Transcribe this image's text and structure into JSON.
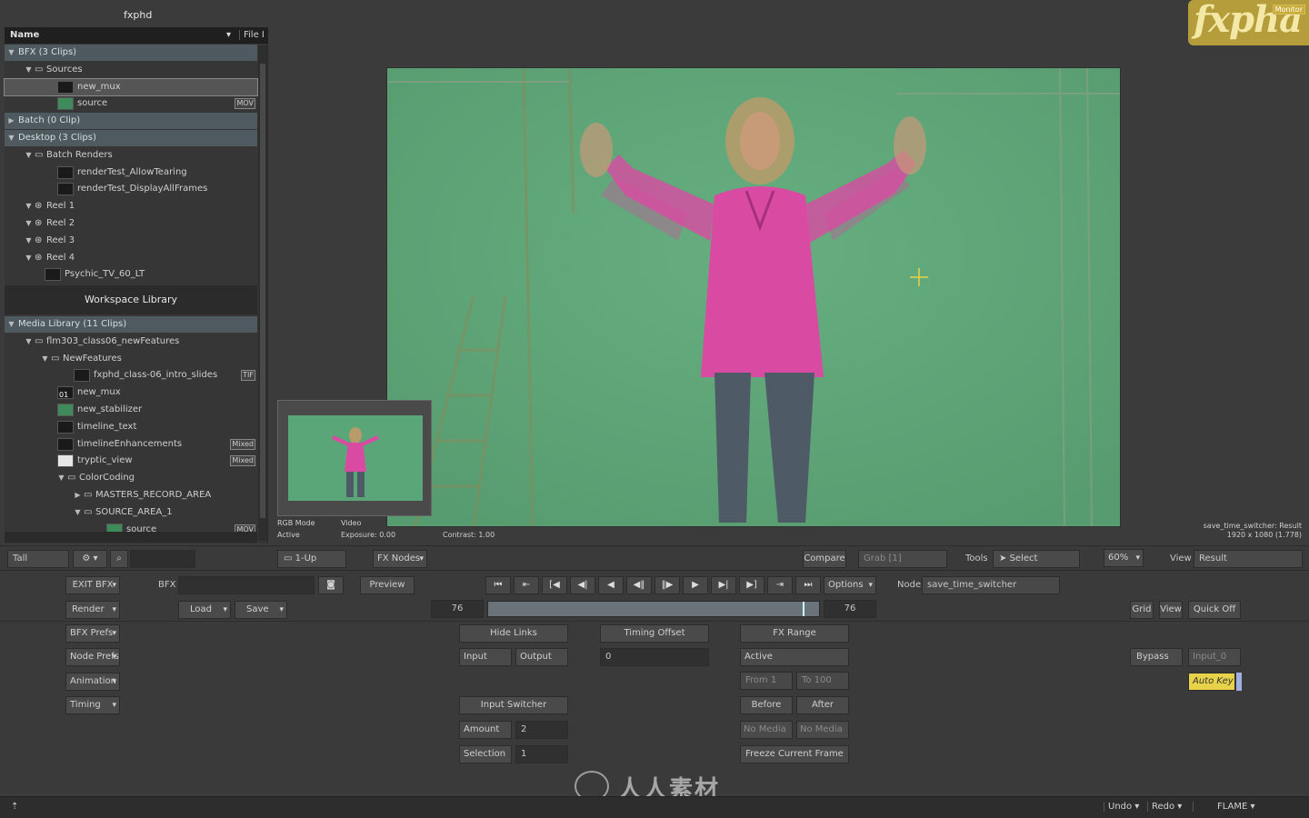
{
  "app": {
    "title": "fxphd"
  },
  "library": {
    "header": {
      "name": "Name",
      "file": "File I"
    },
    "rows": [
      {
        "label": "BFX (3 Clips)",
        "type": "group"
      },
      {
        "label": "Sources",
        "type": "folder"
      },
      {
        "label": "new_mux",
        "type": "clip",
        "selected": true
      },
      {
        "label": "source",
        "type": "clip",
        "tag": "MOV"
      },
      {
        "label": "Batch (0 Clip)",
        "type": "group"
      },
      {
        "label": "Desktop (3 Clips)",
        "type": "group"
      },
      {
        "label": "Batch Renders",
        "type": "folder"
      },
      {
        "label": "renderTest_AllowTearing",
        "type": "clip"
      },
      {
        "label": "renderTest_DisplayAllFrames",
        "type": "clip"
      },
      {
        "label": "Reel 1",
        "type": "reel"
      },
      {
        "label": "Reel 2",
        "type": "reel"
      },
      {
        "label": "Reel 3",
        "type": "reel"
      },
      {
        "label": "Reel 4",
        "type": "reel"
      },
      {
        "label": "Psychic_TV_60_LT",
        "type": "clip"
      }
    ],
    "workspace_library": "Workspace Library",
    "media_rows": [
      {
        "label": "Media Library (11 Clips)",
        "type": "group"
      },
      {
        "label": "flm303_class06_newFeatures",
        "type": "folder"
      },
      {
        "label": "NewFeatures",
        "type": "folder"
      },
      {
        "label": "fxphd_class-06_intro_slides",
        "type": "clip",
        "tag": "TIF"
      },
      {
        "label": "new_mux",
        "type": "clip",
        "badge": "01"
      },
      {
        "label": "new_stabilizer",
        "type": "clip"
      },
      {
        "label": "timeline_text",
        "type": "clip"
      },
      {
        "label": "timelineEnhancements",
        "type": "clip",
        "tag": "Mixed"
      },
      {
        "label": "tryptic_view",
        "type": "clip",
        "tag": "Mixed"
      },
      {
        "label": "ColorCoding",
        "type": "folder"
      },
      {
        "label": "MASTERS_RECORD_AREA",
        "type": "folder"
      },
      {
        "label": "SOURCE_AREA_1",
        "type": "folder"
      },
      {
        "label": "source",
        "type": "clip",
        "tag": "MOV"
      }
    ]
  },
  "logo": {
    "text": "fxpha",
    "badge": "Monitor"
  },
  "viewer_info": {
    "rgb_mode": "RGB Mode",
    "active": "Active",
    "video": "Video",
    "exposure": "Exposure: 0.00",
    "contrast": "Contrast: 1.00",
    "result_line1": "save_time_switcher: Result",
    "result_line2": "1920 x 1080 (1.778)"
  },
  "viewbar": {
    "layout": "Tall",
    "view_mode": "1-Up",
    "fx_nodes": "FX Nodes",
    "compare": "Compare",
    "grab": "Grab [1]",
    "tools": "Tools",
    "select": "Select",
    "zoom": "60%",
    "view_label": "View",
    "view_value": "Result"
  },
  "controls": {
    "exit_bfx": "EXIT BFX",
    "bfx_label": "BFX",
    "preview": "Preview",
    "render": "Render",
    "load": "Load",
    "save": "Save",
    "bfx_prefs": "BFX Prefs",
    "node_prefs": "Node Prefs",
    "animation": "Animation",
    "timing": "Timing",
    "options": "Options",
    "node_label": "Node",
    "node_value": "save_time_switcher",
    "frame_start": "76",
    "frame_end": "76",
    "grid": "Grid",
    "view": "View",
    "quick_off": "Quick Off",
    "hide_links": "Hide Links",
    "input": "Input",
    "output": "Output",
    "timing_offset": "Timing Offset",
    "timing_offset_value": "0",
    "fx_range": "FX Range",
    "active": "Active",
    "from": "From 1",
    "to": "To 100",
    "before": "Before",
    "after": "After",
    "no_media_1": "No Media",
    "no_media_2": "No Media",
    "freeze": "Freeze Current Frame",
    "input_switcher": "Input Switcher",
    "amount": "Amount",
    "amount_value": "2",
    "selection": "Selection",
    "selection_value": "1",
    "bypass": "Bypass",
    "input_0": "Input_0",
    "auto_key": "Auto Key"
  },
  "statusbar": {
    "undo": "Undo",
    "redo": "Redo",
    "app": "FLAME"
  },
  "watermark": "人人素材",
  "colors": {
    "chroma_green": "#5fa87a",
    "shirt_pink": "#d94ba3",
    "auto_key": "#e8d24a",
    "logo_gold": "#b49d3a"
  }
}
